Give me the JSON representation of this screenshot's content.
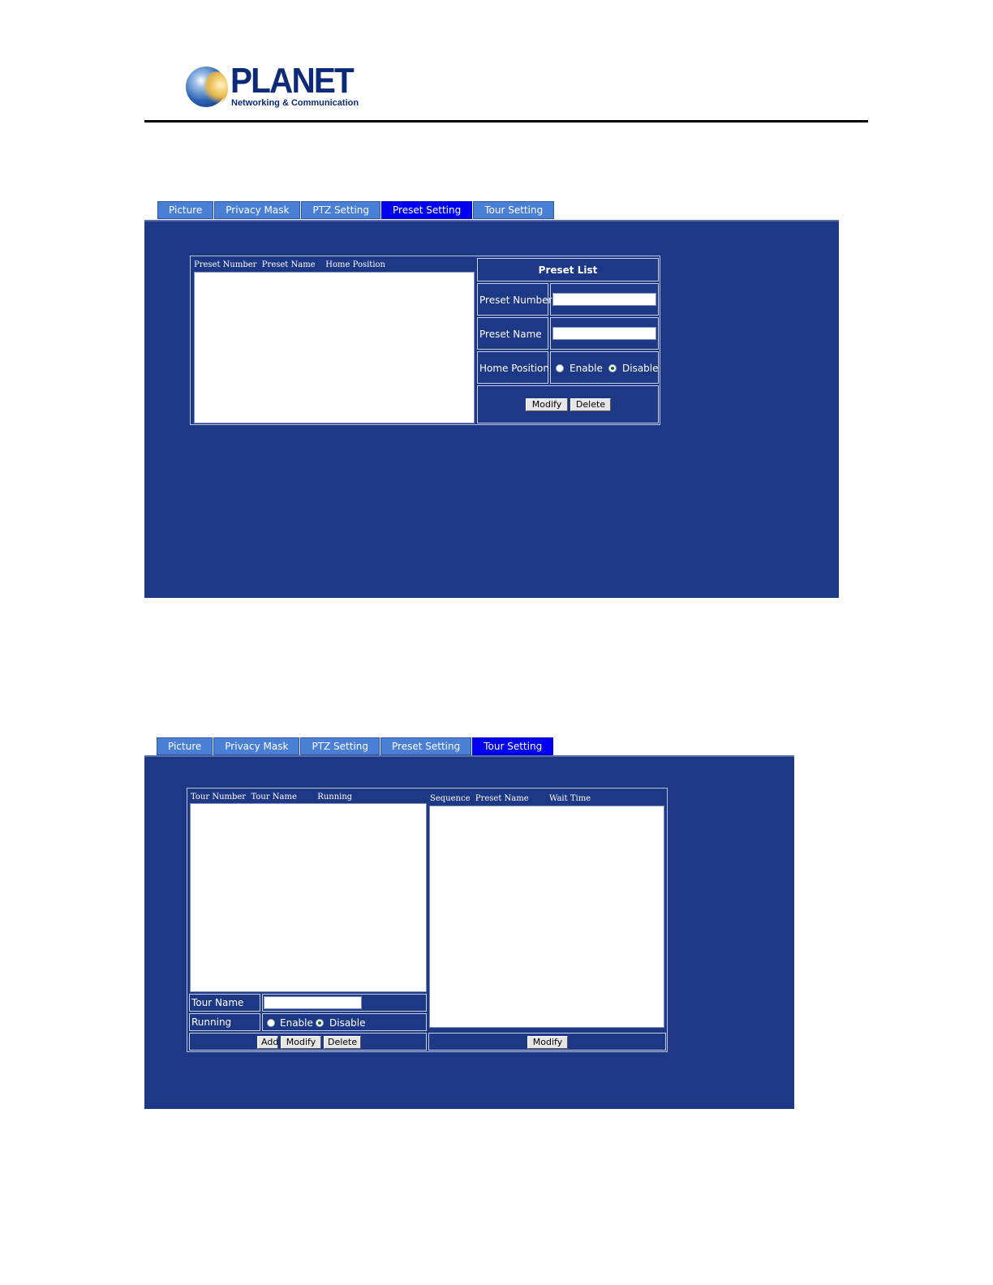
{
  "header": {
    "brand": "PLANET",
    "tagline": "Networking & Communication"
  },
  "tabs": [
    "Picture",
    "Privacy Mask",
    "PTZ Setting",
    "Preset Setting",
    "Tour Setting"
  ],
  "preset_screen": {
    "active_tab": "Preset Setting",
    "list_header": "Preset Number  Preset Name    Home Position",
    "form_title": "Preset List",
    "preset_number_label": "Preset Number",
    "preset_number_value": "",
    "preset_name_label": "Preset Name",
    "preset_name_value": "",
    "home_position_label": "Home Position",
    "enable_label": "Enable",
    "disable_label": "Disable",
    "home_position_selected": "Disable",
    "modify_label": "Modify",
    "delete_label": "Delete"
  },
  "tour_screen": {
    "active_tab": "Tour Setting",
    "tour_list_header": "Tour Number  Tour Name        Running",
    "sequence_list_header": "Sequence  Preset Name        Wait Time",
    "tour_name_label": "Tour Name",
    "tour_name_value": "",
    "running_label": "Running",
    "enable_label": "Enable",
    "disable_label": "Disable",
    "running_selected": "Disable",
    "add_label": "Add",
    "modify_label": "Modify",
    "delete_label": "Delete",
    "sequence_modify_label": "Modify"
  },
  "colors": {
    "panel_bg": "#1d3885",
    "tab_bg": "#4a7fd6",
    "tab_active_bg": "#0000f0"
  }
}
